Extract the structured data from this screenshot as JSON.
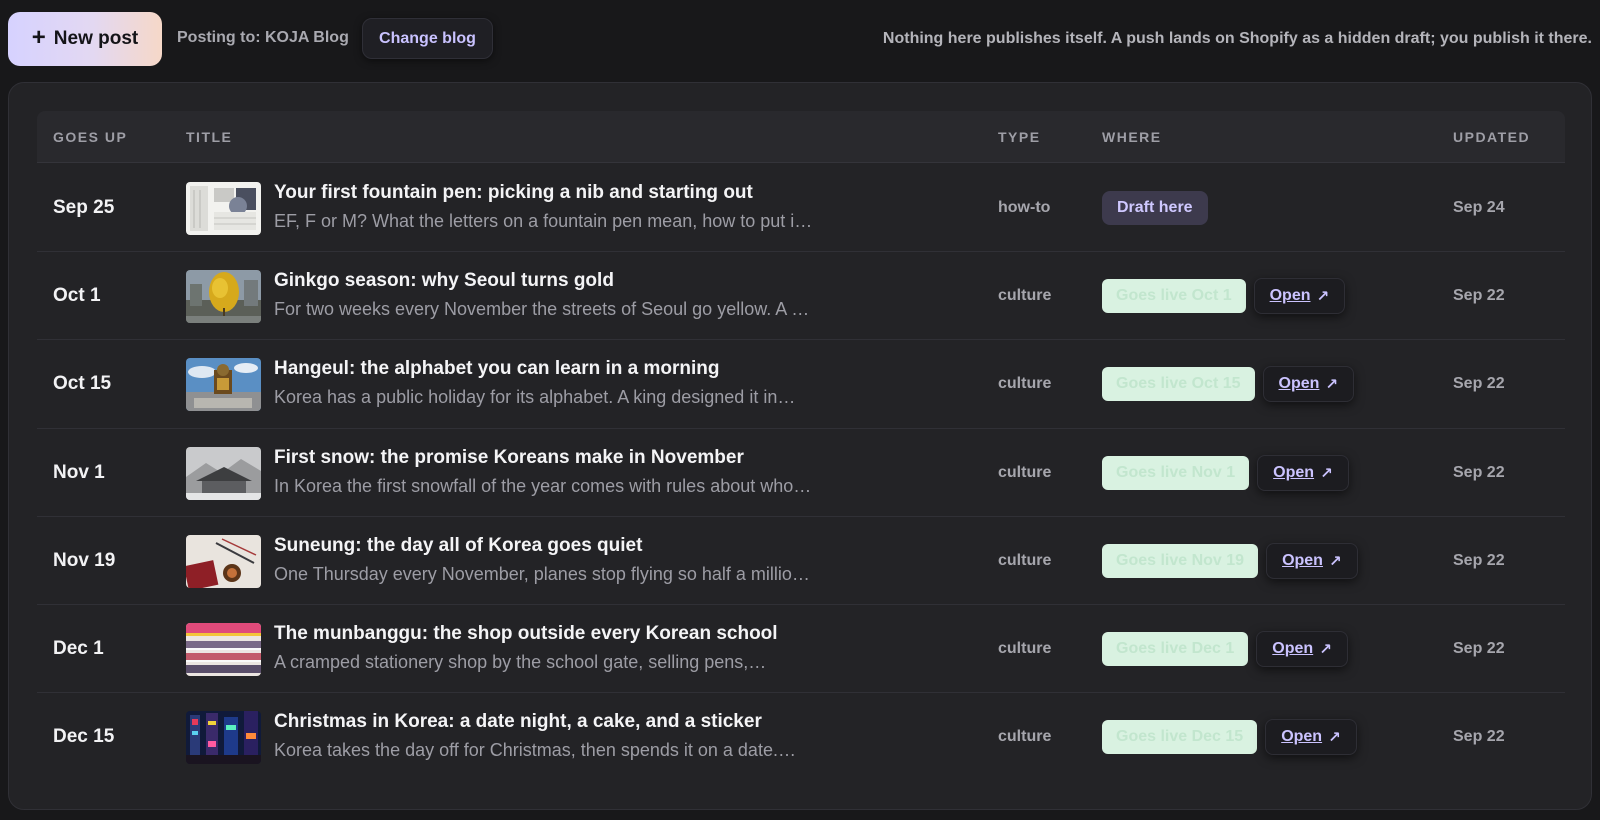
{
  "toolbar": {
    "new_post_label": "New post",
    "new_post_icon": "plus-icon",
    "posting_to": "Posting to: KOJA Blog",
    "change_blog_label": "Change blog",
    "notice": "Nothing here publishes itself. A push lands on Shopify as a hidden draft; you publish it there."
  },
  "table": {
    "headers": {
      "goes_up": "GOES UP",
      "title": "TITLE",
      "type": "TYPE",
      "where": "WHERE",
      "updated": "UPDATED"
    },
    "open_label": "Open",
    "open_icon": "external-link-icon",
    "rows": [
      {
        "goes_up": "Sep 25",
        "title": "Your first fountain pen: picking a nib and starting out",
        "excerpt": "EF, F or M? What the letters on a fountain pen mean, how to put i…",
        "type": "how-to",
        "status": "Draft here",
        "status_kind": "draft",
        "updated": "Sep 24"
      },
      {
        "goes_up": "Oct 1",
        "title": "Ginkgo season: why Seoul turns gold",
        "excerpt": "For two weeks every November the streets of Seoul go yellow. A …",
        "type": "culture",
        "status": "Goes live Oct 1",
        "status_kind": "live",
        "updated": "Sep 22"
      },
      {
        "goes_up": "Oct 15",
        "title": "Hangeul: the alphabet you can learn in a morning",
        "excerpt": "Korea has a public holiday for its alphabet. A king designed it in…",
        "type": "culture",
        "status": "Goes live Oct 15",
        "status_kind": "live",
        "updated": "Sep 22"
      },
      {
        "goes_up": "Nov 1",
        "title": "First snow: the promise Koreans make in November",
        "excerpt": "In Korea the first snowfall of the year comes with rules about who…",
        "type": "culture",
        "status": "Goes live Nov 1",
        "status_kind": "live",
        "updated": "Sep 22"
      },
      {
        "goes_up": "Nov 19",
        "title": "Suneung: the day all of Korea goes quiet",
        "excerpt": "One Thursday every November, planes stop flying so half a millio…",
        "type": "culture",
        "status": "Goes live Nov 19",
        "status_kind": "live",
        "updated": "Sep 22"
      },
      {
        "goes_up": "Dec 1",
        "title": "The munbanggu: the shop outside every Korean school",
        "excerpt": "A cramped stationery shop by the school gate, selling pens,…",
        "type": "culture",
        "status": "Goes live Dec 1",
        "status_kind": "live",
        "updated": "Sep 22"
      },
      {
        "goes_up": "Dec 15",
        "title": "Christmas in Korea: a date night, a cake, and a sticker",
        "excerpt": "Korea takes the day off for Christmas, then spends it on a date.…",
        "type": "culture",
        "status": "Goes live Dec 15",
        "status_kind": "live",
        "updated": "Sep 22"
      }
    ]
  }
}
